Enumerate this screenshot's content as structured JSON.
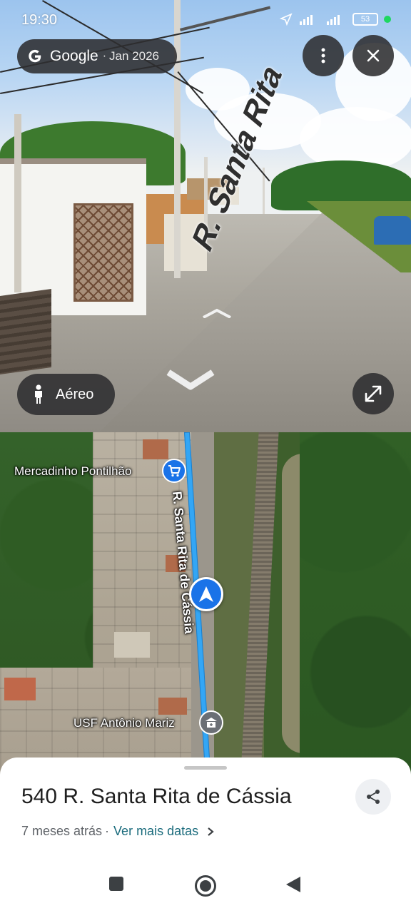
{
  "status_bar": {
    "time": "19:30",
    "battery": "53"
  },
  "streetview": {
    "brand": "Google",
    "separator": "·",
    "date": "Jan 2026",
    "street_label": "R. Santa Rita",
    "mode_label": "Aéreo",
    "icons": [
      "google-g-icon",
      "more-vert-icon",
      "close-icon",
      "pegman-icon",
      "expand-icon",
      "chevron-up-icon",
      "chevron-down-icon"
    ]
  },
  "map": {
    "street_label": "R. Santa Rita de Cássia",
    "poi": [
      {
        "name": "Mercadinho Pontilhão",
        "icon": "shopping-cart-icon",
        "color": "#1a73e8"
      },
      {
        "name": "USF Antônio Mariz",
        "icon": "hospital-icon",
        "color": "#5f6368"
      }
    ],
    "route_color": "#33a6f5"
  },
  "sheet": {
    "title": "540 R. Santa Rita de Cássia",
    "age": "7 meses atrás",
    "separator": "·",
    "link": "Ver mais datas",
    "link_color": "#1a6b7c"
  },
  "nav": {
    "icons": [
      "recents-square-icon",
      "home-circle-icon",
      "back-triangle-icon"
    ]
  }
}
